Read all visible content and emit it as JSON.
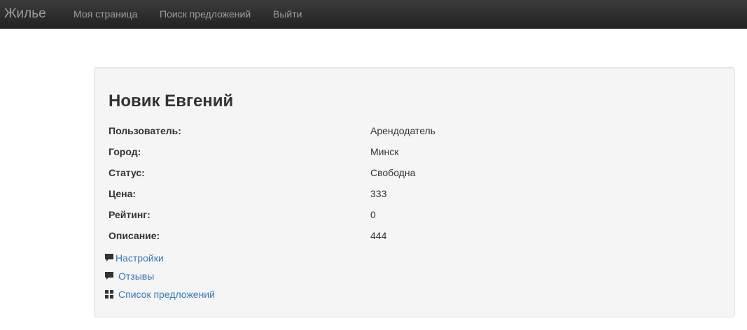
{
  "navbar": {
    "brand": "Жилье",
    "links": [
      "Моя страница",
      "Поиск предложений",
      "Выйти"
    ]
  },
  "profile": {
    "name": "Новик Евгений",
    "fields": [
      {
        "label": "Пользователь:",
        "value": "Арендодатель"
      },
      {
        "label": "Город:",
        "value": "Минск"
      },
      {
        "label": "Статус:",
        "value": "Свободна"
      },
      {
        "label": "Цена:",
        "value": "333"
      },
      {
        "label": "Рейтинг:",
        "value": "0"
      },
      {
        "label": "Описание:",
        "value": "444"
      }
    ],
    "actions": [
      {
        "label": "Настройки",
        "icon": "comment-icon"
      },
      {
        "label": "Отзывы",
        "icon": "comment-icon"
      },
      {
        "label": "Список предложений",
        "icon": "th-large-icon"
      }
    ]
  },
  "colors": {
    "navbar_bg": "#222222",
    "nav_text": "#9d9d9d",
    "panel_bg": "#f5f5f5",
    "link": "#337ab7",
    "text": "#333333"
  }
}
